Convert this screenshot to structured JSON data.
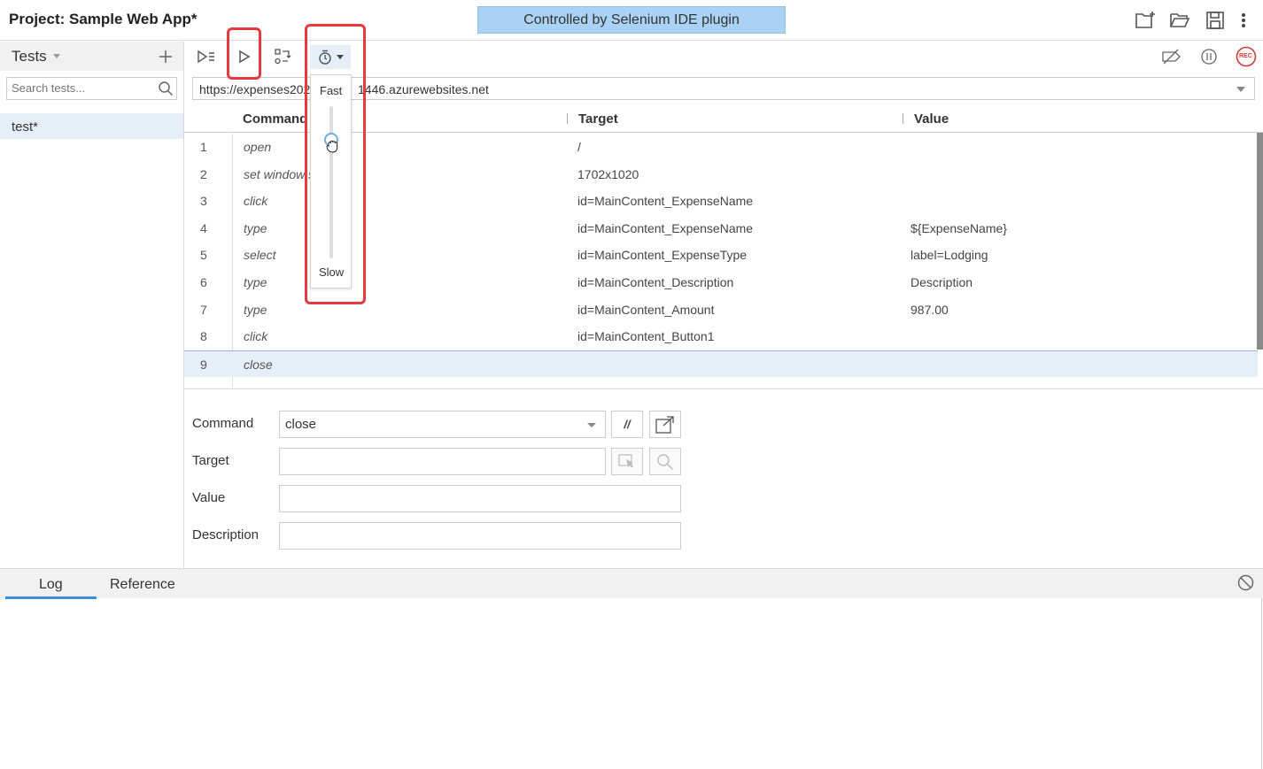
{
  "header": {
    "project_label": "Project:",
    "project_name": "Sample Web App*",
    "banner": "Controlled by Selenium IDE plugin"
  },
  "sidebar": {
    "title": "Tests",
    "search_placeholder": "Search tests...",
    "tests": [
      "test*"
    ]
  },
  "toolbar": {
    "speed": {
      "fast_label": "Fast",
      "slow_label": "Slow",
      "level": 0.22
    },
    "rec_label": "REC"
  },
  "url": "https://expenses20200911446.azurewebsites.net",
  "url_visible": "https://expenses202",
  "url_visible_tail": "1446.azurewebsites.net",
  "table": {
    "headers": {
      "command": "Command",
      "target": "Target",
      "value": "Value"
    },
    "rows": [
      {
        "num": "1",
        "command": "open",
        "target": "/",
        "value": ""
      },
      {
        "num": "2",
        "command": "set window s",
        "target": "1702x1020",
        "value": ""
      },
      {
        "num": "3",
        "command": "click",
        "target": "id=MainContent_ExpenseName",
        "value": ""
      },
      {
        "num": "4",
        "command": "type",
        "target": "id=MainContent_ExpenseName",
        "value": "${ExpenseName}"
      },
      {
        "num": "5",
        "command": "select",
        "target": "id=MainContent_ExpenseType",
        "value": "label=Lodging"
      },
      {
        "num": "6",
        "command": "type",
        "target": "id=MainContent_Description",
        "value": "Description"
      },
      {
        "num": "7",
        "command": "type",
        "target": "id=MainContent_Amount",
        "value": "987.00"
      },
      {
        "num": "8",
        "command": "click",
        "target": "id=MainContent_Button1",
        "value": ""
      },
      {
        "num": "9",
        "command": "close",
        "target": "",
        "value": ""
      }
    ],
    "selected_row": 9
  },
  "editor": {
    "command_label": "Command",
    "command_value": "close",
    "comment_btn": "//",
    "target_label": "Target",
    "value_label": "Value",
    "description_label": "Description"
  },
  "bottom": {
    "tabs": [
      "Log",
      "Reference"
    ]
  }
}
